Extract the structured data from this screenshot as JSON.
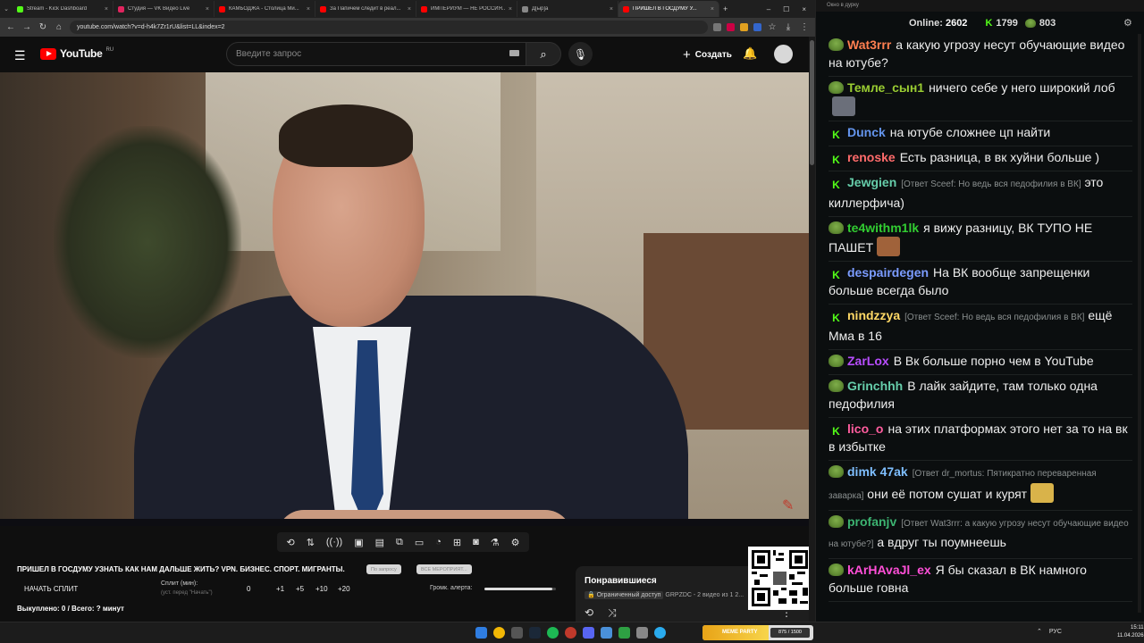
{
  "browser": {
    "tabs": [
      {
        "title": "Stream - Kick Dashboard",
        "color": "#53fc18"
      },
      {
        "title": "Студия — VK Видео Live",
        "color": "#e0245e"
      },
      {
        "title": "КАМБОДЖА - Столица Ми...",
        "color": "#ff0000"
      },
      {
        "title": "За Папичем следит в реал...",
        "color": "#ff0000"
      },
      {
        "title": "ИМПЕРИУМ — НЕ РОССИЯ...",
        "color": "#ff0000"
      },
      {
        "title": "Д[ыр]а",
        "color": "#888888"
      },
      {
        "title": "ПРИШЕЛ В ГОСДУМУ У...",
        "color": "#ff0000"
      }
    ],
    "url": "youtube.com/watch?v=d-h4k7Zr1rU&list=LL&index=2",
    "tab_close": "×",
    "new_tab": "+",
    "window_controls": [
      "–",
      "☐",
      "×"
    ]
  },
  "youtube": {
    "logo_text": "YouTube",
    "region": "RU",
    "search_placeholder": "Введите запрос",
    "create_label": "Создать",
    "video_title": "ПРИШЕЛ В ГОСДУМУ УЗНАТЬ КАК НАМ ДАЛЬШЕ ЖИТЬ? VPN. БИЗНЕС. СПОРТ. МИГРАНТЫ.",
    "pill_subs": "По запросу",
    "pill_more": "ВСЕ МЕРОПРИЯТ...",
    "split_start": "НАЧАТЬ СПЛИТ",
    "split_label": "Сплит (мин):",
    "split_sub": "(уст. перед \"Начать\")",
    "split_values": [
      "0",
      "+1",
      "+5",
      "+10",
      "+20"
    ],
    "volume_label": "Громк. алерта:",
    "volume_level": 0.95,
    "bought": "Выкуплено: 0 / Всего: ? минут",
    "liked_title": "Понравившиеся",
    "liked_access": "Ограниченный доступ",
    "liked_meta": "GRPZDC - 2 видео из 1 2...",
    "liked_more": "⋮"
  },
  "taskbar": {
    "meme_label": "MEME PARTY",
    "meme_count": "875 / 1500",
    "lang": "РУС",
    "time": "15:11",
    "date": "11.04.2026"
  },
  "chat": {
    "window_title": "Окно в дурку",
    "online_label": "Online:",
    "online_count": "2602",
    "kick_count": "1799",
    "pepe_count": "803",
    "messages": [
      {
        "badge": "pepe",
        "user": "Wat3rrr",
        "color": "#ff7f50",
        "reply": "",
        "text": "а какую угрозу несут обучающие видео на ютубе?",
        "emote": ""
      },
      {
        "badge": "pepe",
        "user": "Темле_сын1",
        "color": "#9acd32",
        "reply": "",
        "text": "ничего себе у него широкий лоб",
        "emote": "#6b6f7a"
      },
      {
        "badge": "kick",
        "user": "Dunck",
        "color": "#6495ed",
        "reply": "",
        "text": "на ютубе сложнее цп найти",
        "emote": ""
      },
      {
        "badge": "kick",
        "user": "renoske",
        "color": "#ff6b6b",
        "reply": "",
        "text": "Есть разница, в вк хуйни больше )",
        "emote": ""
      },
      {
        "badge": "kick",
        "user": "Jewgien",
        "color": "#66cdaa",
        "reply": "[Ответ Sceef: Но ведь вся педофилия в ВК]",
        "text": "это киллерфича)",
        "emote": ""
      },
      {
        "badge": "pepe",
        "user": "te4withm1lk",
        "color": "#32cd32",
        "reply": "",
        "text": "я вижу разницу, ВК ТУПО НЕ ПАШЕТ",
        "emote": "#a0623a"
      },
      {
        "badge": "kick",
        "user": "despairdegen",
        "color": "#7b9cff",
        "reply": "",
        "text": "На ВК вообще запрещенки больше всегда было",
        "emote": ""
      },
      {
        "badge": "kick",
        "user": "nindzzya",
        "color": "#ffd966",
        "reply": "[Ответ Sceef: Но ведь вся педофилия в ВК]",
        "text": "ещё Мма в 16",
        "emote": ""
      },
      {
        "badge": "pepe",
        "user": "ZarLox",
        "color": "#b84dff",
        "reply": "",
        "text": "В Вк больше порно чем в YouTube",
        "emote": ""
      },
      {
        "badge": "pepe",
        "user": "Grinchhh",
        "color": "#66cdaa",
        "reply": "",
        "text": "В лайк зайдите, там только одна педофилия",
        "emote": ""
      },
      {
        "badge": "kick",
        "user": "lico_o",
        "color": "#ff5d9e",
        "reply": "",
        "text": "на этих платформах этого нет за то на вк в избытке",
        "emote": ""
      },
      {
        "badge": "pepe",
        "user": "dimk 47ak",
        "color": "#7fbfff",
        "reply": "[Ответ dr_mortus: Пятикратно переваренная заварка]",
        "text": "они её потом сушат и курят",
        "emote": "#d9b34a"
      },
      {
        "badge": "pepe",
        "user": "profanjv",
        "color": "#3cb371",
        "reply": "[Ответ Wat3rrr: а какую угрозу несут обучающие видео на ютубе?]",
        "text": "а вдруг ты поумнеешь",
        "emote": ""
      },
      {
        "badge": "pepe",
        "user": "kArHAvaJl_ex",
        "color": "#ff4fd8",
        "reply": "",
        "text": "Я бы сказал в ВК намного больше говна",
        "emote": ""
      }
    ]
  }
}
